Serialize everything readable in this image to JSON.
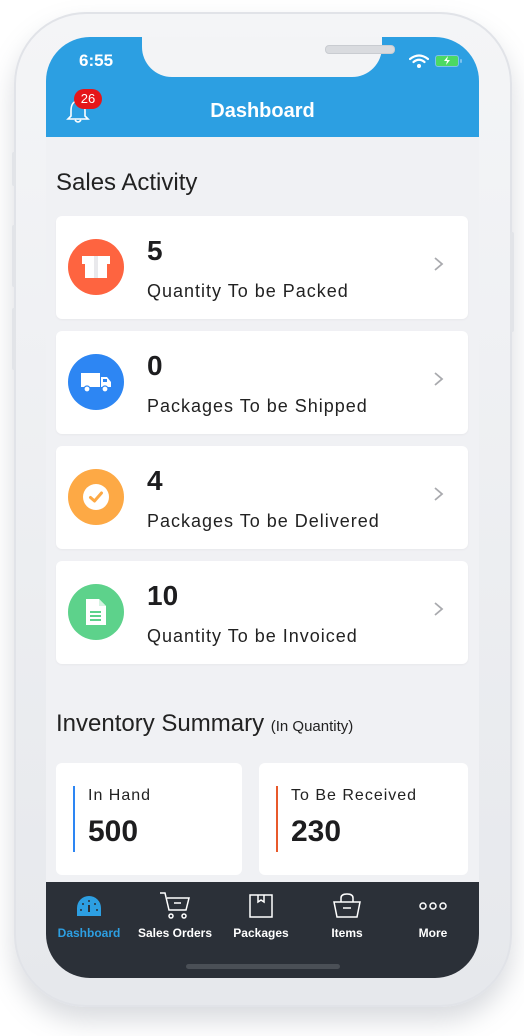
{
  "status_bar": {
    "time": "6:55"
  },
  "header": {
    "title": "Dashboard",
    "notification_count": "26"
  },
  "sales_activity": {
    "title": "Sales Activity",
    "items": [
      {
        "value": "5",
        "label": "Quantity To be Packed",
        "icon": "package-icon",
        "color": "#fe6440"
      },
      {
        "value": "0",
        "label": "Packages To be Shipped",
        "icon": "truck-icon",
        "color": "#2d86f3"
      },
      {
        "value": "4",
        "label": "Packages To be Delivered",
        "icon": "check-circle-icon",
        "color": "#fda945"
      },
      {
        "value": "10",
        "label": "Quantity To be Invoiced",
        "icon": "invoice-icon",
        "color": "#5dd28b"
      }
    ]
  },
  "inventory_summary": {
    "title": "Inventory Summary",
    "subtitle": "(In Quantity)",
    "items": [
      {
        "label": "In Hand",
        "value": "500",
        "accent": "#2d86f3"
      },
      {
        "label": "To Be Received",
        "value": "230",
        "accent": "#e8592b"
      }
    ]
  },
  "tabbar": {
    "items": [
      {
        "label": "Dashboard",
        "icon": "dashboard-gauge-icon",
        "active": true
      },
      {
        "label": "Sales Orders",
        "icon": "cart-icon",
        "active": false
      },
      {
        "label": "Packages",
        "icon": "box-icon",
        "active": false
      },
      {
        "label": "Items",
        "icon": "basket-icon",
        "active": false
      },
      {
        "label": "More",
        "icon": "more-dots-icon",
        "active": false
      }
    ]
  },
  "colors": {
    "header": "#2c9fe2",
    "tabbar": "#2b3038",
    "active_tab": "#2d9fe2",
    "badge": "#e5161a"
  }
}
